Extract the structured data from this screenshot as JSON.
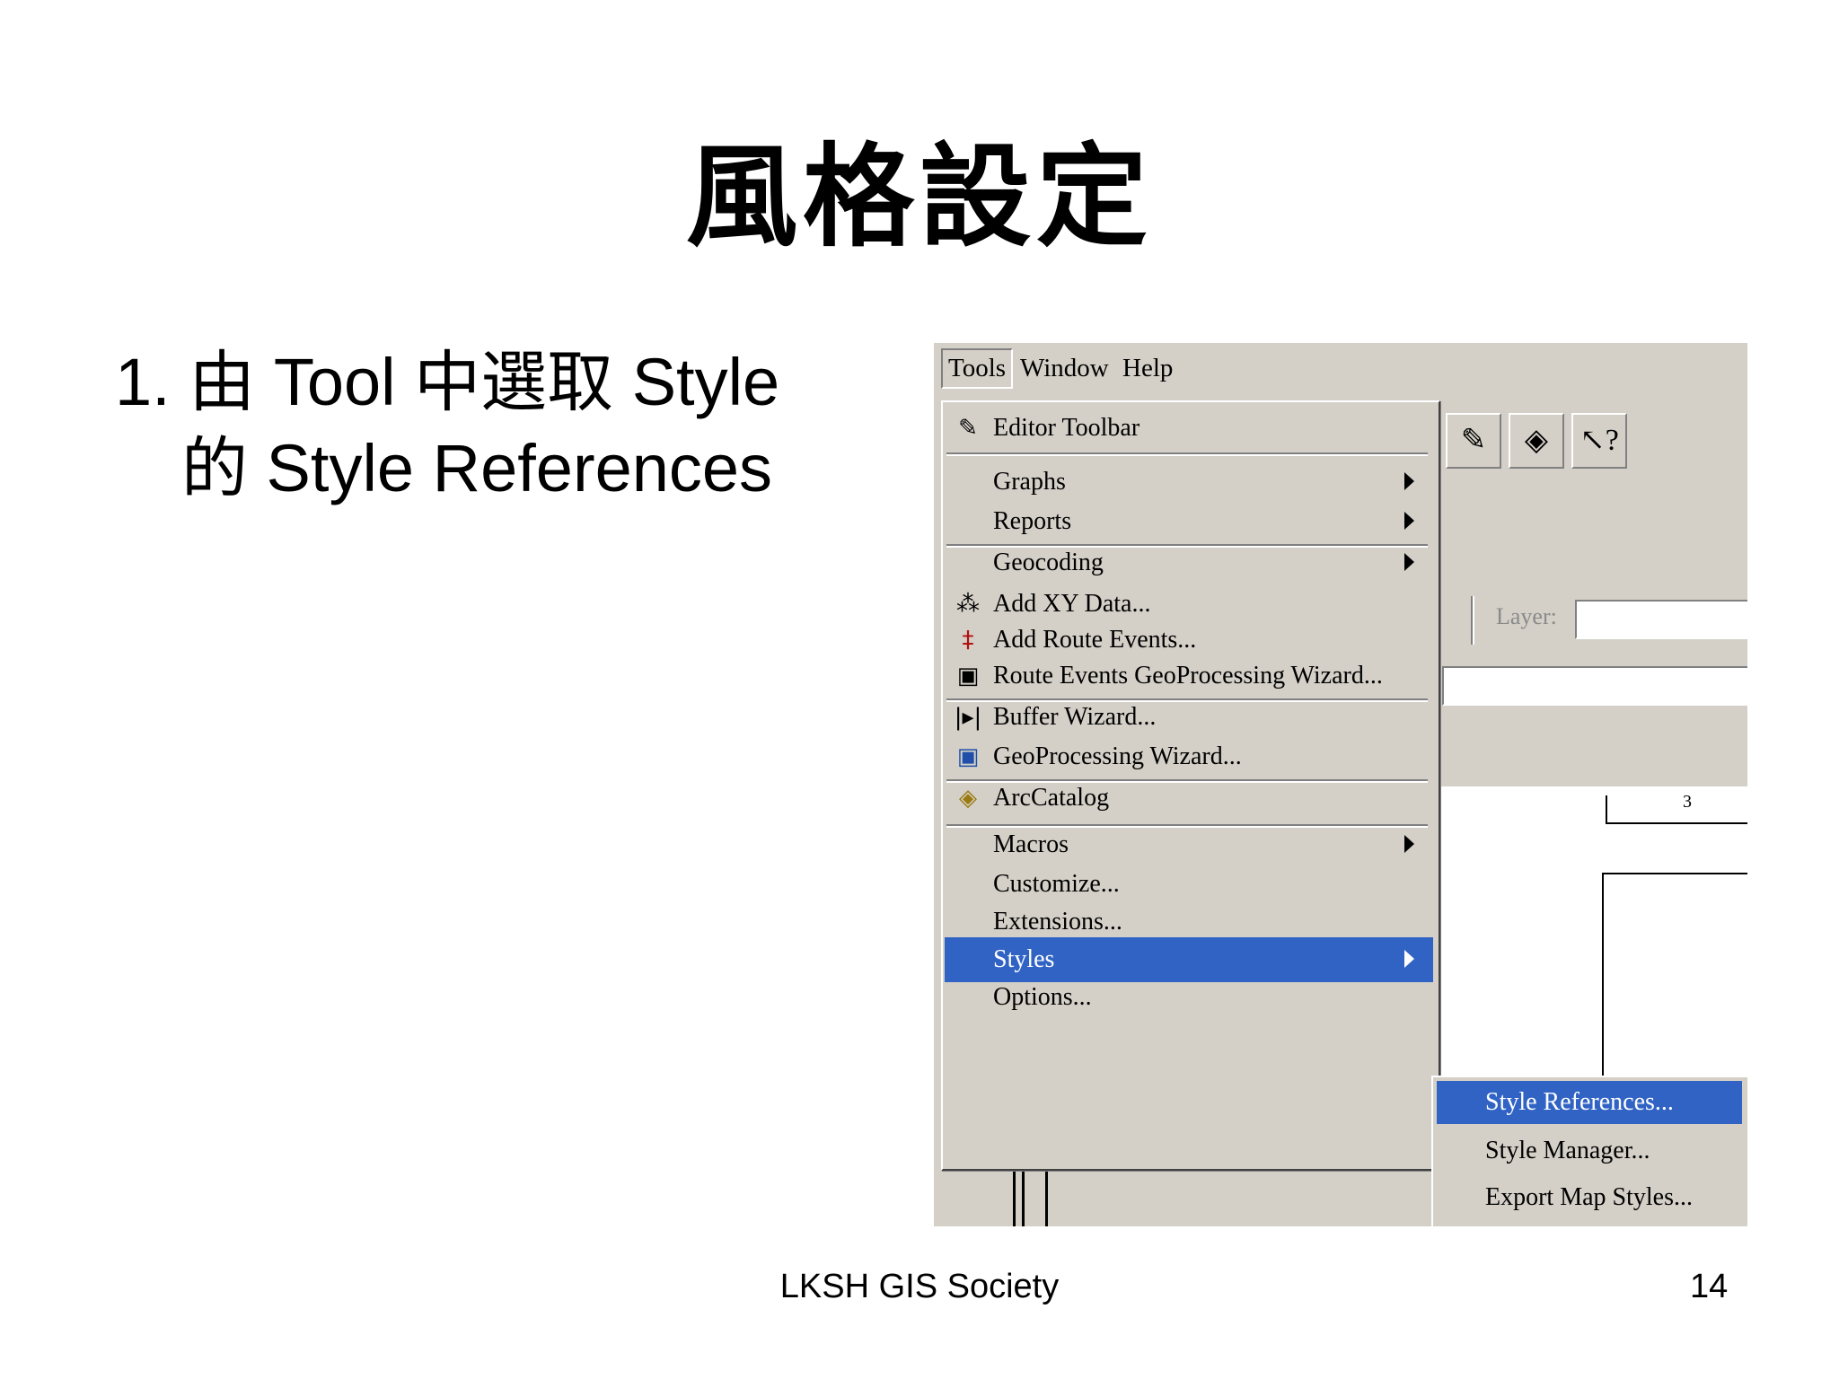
{
  "slide": {
    "title": "風格設定",
    "bullet_line1": "1. 由 Tool  中選取  Style",
    "bullet_line2": "的 Style References",
    "footer": "LKSH  GIS Society",
    "page_number": "14"
  },
  "menubar": {
    "tools": "Tools",
    "window": "Window",
    "help": "Help"
  },
  "toolbar": {
    "layer_label": "Layer:",
    "ruler_mark": "3"
  },
  "menu": {
    "editor_toolbar": "Editor Toolbar",
    "graphs": "Graphs",
    "reports": "Reports",
    "geocoding": "Geocoding",
    "add_xy_data": "Add XY Data...",
    "add_route_events": "Add Route Events...",
    "route_events_wizard": "Route Events GeoProcessing Wizard...",
    "buffer_wizard": "Buffer Wizard...",
    "geoprocessing_wizard": "GeoProcessing Wizard...",
    "arccatalog": "ArcCatalog",
    "macros": "Macros",
    "customize": "Customize...",
    "extensions": "Extensions...",
    "styles": "Styles",
    "options": "Options..."
  },
  "submenu": {
    "style_references": "Style References...",
    "style_manager": "Style Manager...",
    "export_map_styles": "Export Map Styles..."
  },
  "icons": {
    "editor": "editor-pencil-icon",
    "xy": "xy-data-icon",
    "route": "route-events-icon",
    "wizard": "wizard-icon",
    "buffer": "buffer-icon",
    "arccatalog": "arccatalog-icon",
    "help": "whats-this-icon"
  },
  "colors": {
    "menu_bg": "#d4d0c8",
    "highlight": "#3163c5"
  }
}
